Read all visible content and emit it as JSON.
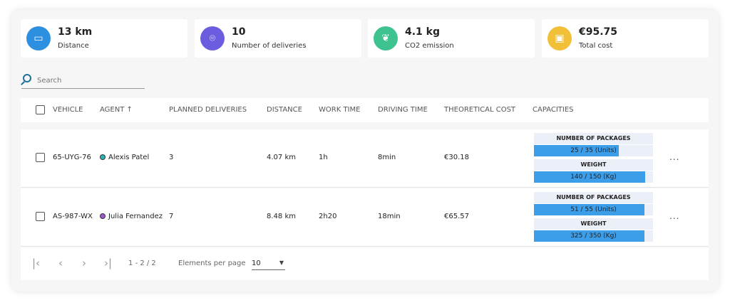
{
  "stats": [
    {
      "value": "13 km",
      "label": "Distance",
      "color": "#2d8fe0",
      "icon": "road-icon"
    },
    {
      "value": "10",
      "label": "Number of deliveries",
      "color": "#6b5ce0",
      "icon": "map-pin-icon"
    },
    {
      "value": "4.1 kg",
      "label": "CO2 emission",
      "color": "#3ec28f",
      "icon": "leaf-icon"
    },
    {
      "value": "€95.75",
      "label": "Total cost",
      "color": "#f2c038",
      "icon": "banknote-icon"
    }
  ],
  "search": {
    "placeholder": "Search"
  },
  "columns": [
    "VEHICLE",
    "AGENT ↑",
    "PLANNED DELIVERIES",
    "DISTANCE",
    "WORK TIME",
    "DRIVING TIME",
    "THEORETICAL COST",
    "CAPACITIES"
  ],
  "rows": [
    {
      "vehicle": "65-UYG-76",
      "agent": "Alexis Patel",
      "agent_color": "#2bb5b0",
      "planned": "3",
      "distance": "4.07 km",
      "work_time": "1h",
      "driving_time": "8min",
      "cost": "€30.18",
      "capacities": [
        {
          "title": "NUMBER OF PACKAGES",
          "text": "25 / 35 (Units)",
          "fraction": 0.714
        },
        {
          "title": "WEIGHT",
          "text": "140 / 150 (Kg)",
          "fraction": 0.933
        }
      ]
    },
    {
      "vehicle": "AS-987-WX",
      "agent": "Julia Fernandez",
      "agent_color": "#9b59d0",
      "planned": "7",
      "distance": "8.48 km",
      "work_time": "2h20",
      "driving_time": "18min",
      "cost": "€65.57",
      "capacities": [
        {
          "title": "NUMBER OF PACKAGES",
          "text": "51 / 55 (Units)",
          "fraction": 0.927
        },
        {
          "title": "WEIGHT",
          "text": "325 / 350 (Kg)",
          "fraction": 0.929
        }
      ]
    }
  ],
  "more_label": "...",
  "pagination": {
    "range": "1 - 2 / 2",
    "per_page_label": "Elements per page",
    "per_page": "10"
  }
}
